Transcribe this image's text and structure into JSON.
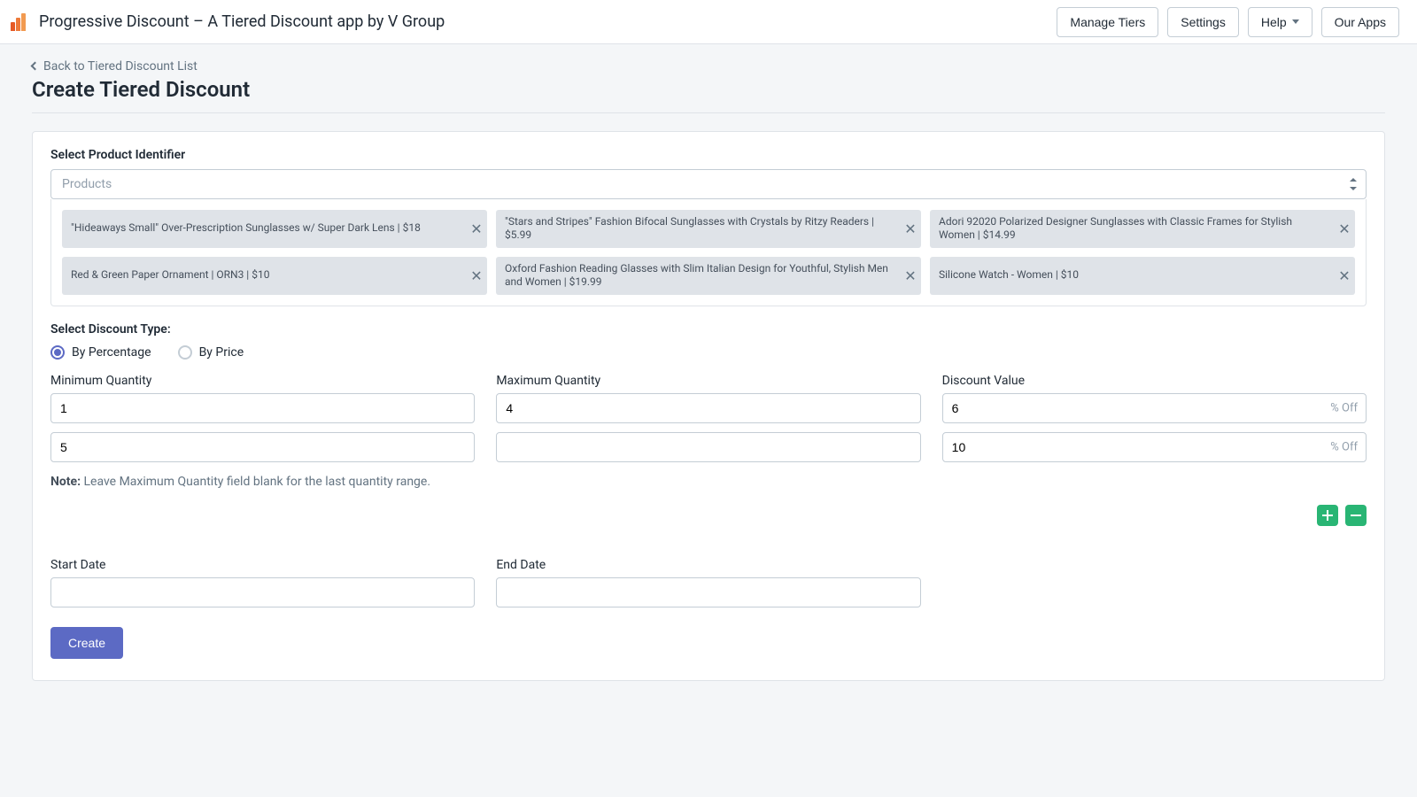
{
  "header": {
    "app_title": "Progressive Discount – A Tiered Discount app by V Group",
    "nav": {
      "manage_tiers": "Manage Tiers",
      "settings": "Settings",
      "help": "Help",
      "our_apps": "Our Apps"
    }
  },
  "page": {
    "back_link": "Back to Tiered Discount List",
    "title": "Create Tiered Discount"
  },
  "form": {
    "product_identifier": {
      "label": "Select Product Identifier",
      "selected": "Products",
      "chips": [
        "\"Hideaways Small\" Over-Prescription Sunglasses w/ Super Dark Lens | $18",
        "\"Stars and Stripes\" Fashion Bifocal Sunglasses with Crystals by Ritzy Readers | $5.99",
        "Adori 92020 Polarized Designer Sunglasses with Classic Frames for Stylish Women | $14.99",
        "Red & Green Paper Ornament | ORN3 | $10",
        "Oxford Fashion Reading Glasses with Slim Italian Design for Youthful, Stylish Men and Women | $19.99",
        "Silicone Watch - Women | $10"
      ]
    },
    "discount_type": {
      "label": "Select Discount Type:",
      "option_percentage": "By Percentage",
      "option_price": "By Price",
      "selected": "percentage"
    },
    "columns": {
      "min_qty": "Minimum Quantity",
      "max_qty": "Maximum Quantity",
      "discount_value": "Discount Value",
      "suffix": "% Off"
    },
    "tiers": [
      {
        "min": "1",
        "max": "4",
        "value": "6"
      },
      {
        "min": "5",
        "max": "",
        "value": "10"
      }
    ],
    "note_label": "Note:",
    "note_text": "Leave Maximum Quantity field blank for the last quantity range.",
    "dates": {
      "start_label": "Start Date",
      "end_label": "End Date",
      "start_value": "",
      "end_value": ""
    },
    "create_label": "Create"
  }
}
